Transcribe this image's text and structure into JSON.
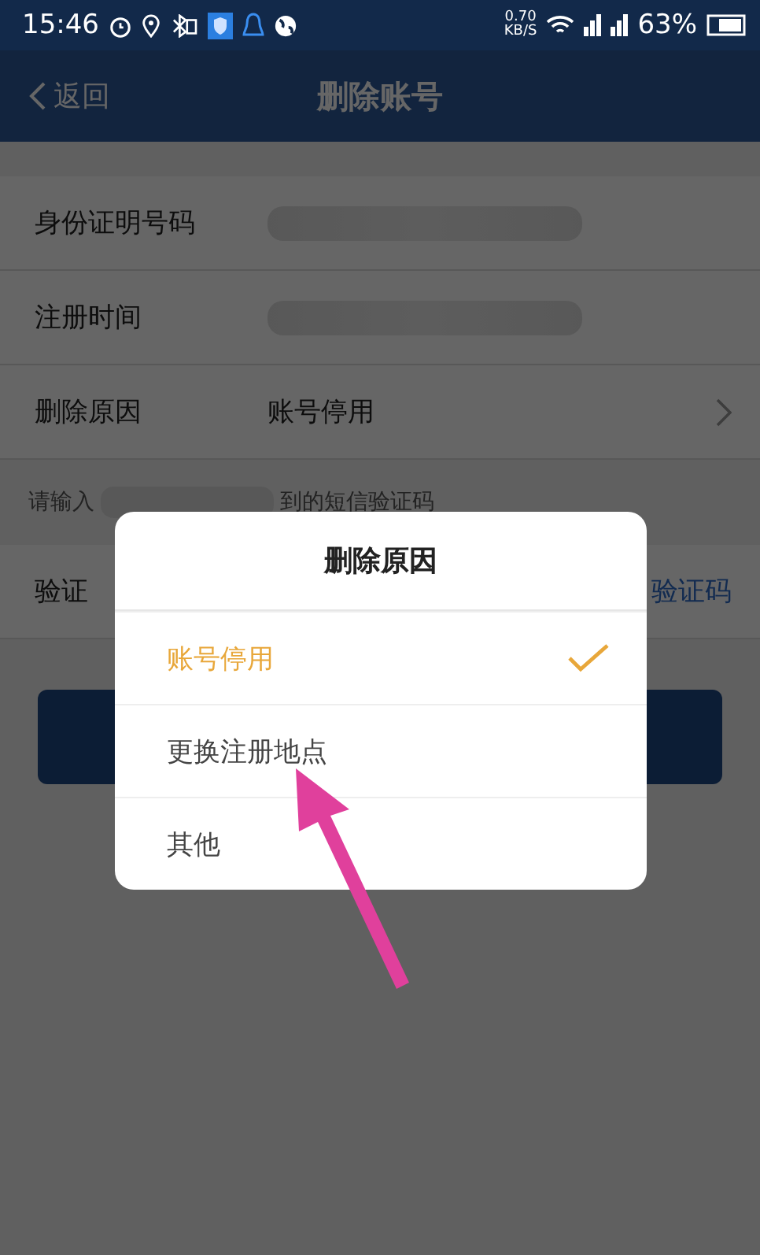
{
  "status_bar": {
    "time": "15:46",
    "speed": "0.70",
    "speed_unit": "KB/S",
    "battery": "63%"
  },
  "nav": {
    "back": "返回",
    "title": "删除账号"
  },
  "rows": [
    {
      "kind": "redacted",
      "label": "身份证明号码"
    },
    {
      "kind": "redacted",
      "label": "注册时间"
    },
    {
      "kind": "select",
      "label": "删除原因",
      "value": "账号停用"
    }
  ],
  "sms_hint": {
    "prefix": "请输入",
    "suffix": "到的短信验证码"
  },
  "code_row": {
    "label": "验证",
    "link": "验证码"
  },
  "dialog": {
    "title": "删除原因",
    "options": [
      {
        "label": "账号停用",
        "selected": true
      },
      {
        "label": "更换注册地点",
        "selected": false
      },
      {
        "label": "其他",
        "selected": false
      }
    ]
  }
}
